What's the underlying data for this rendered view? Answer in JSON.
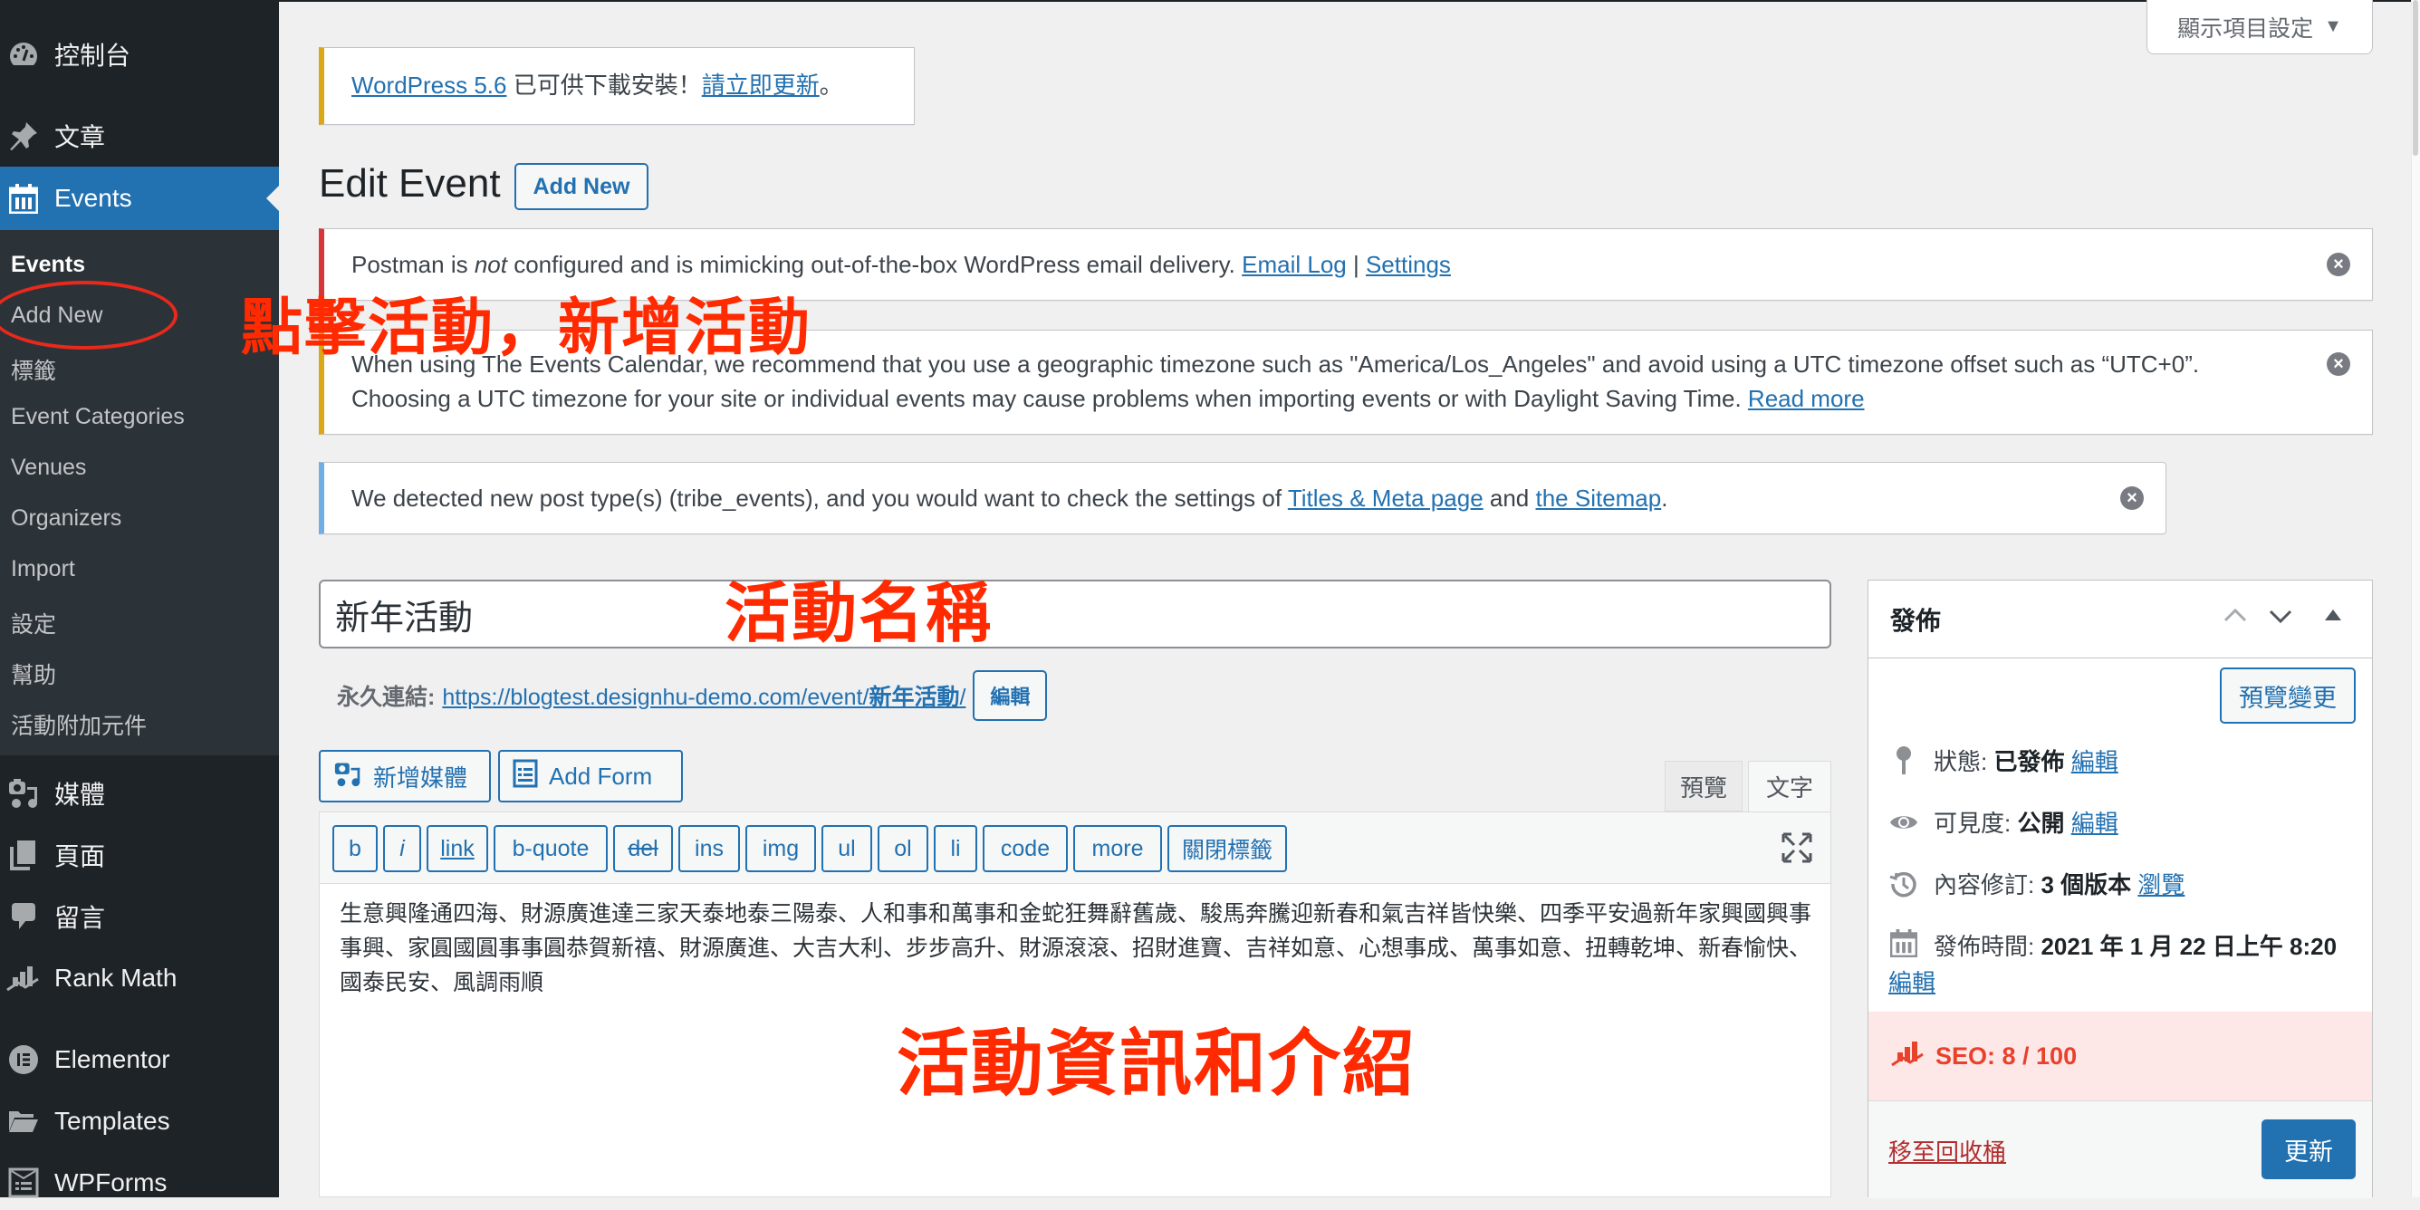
{
  "sidebar": {
    "top_items": [
      {
        "label": "控制台",
        "icon": "dashboard-icon"
      },
      {
        "label": "文章",
        "icon": "pin-icon"
      },
      {
        "label": "Events",
        "icon": "calendar-icon",
        "active": true
      }
    ],
    "submenu": [
      "Events",
      "Add New",
      "標籤",
      "Event Categories",
      "Venues",
      "Organizers",
      "Import",
      "設定",
      "幫助",
      "活動附加元件"
    ],
    "bottom_items": [
      {
        "label": "媒體",
        "icon": "media-icon"
      },
      {
        "label": "頁面",
        "icon": "pages-icon"
      },
      {
        "label": "留言",
        "icon": "comments-icon"
      },
      {
        "label": "Rank Math",
        "icon": "rank-math-icon"
      },
      {
        "label": "Elementor",
        "icon": "elementor-icon"
      },
      {
        "label": "Templates",
        "icon": "folder-icon"
      },
      {
        "label": "WPForms",
        "icon": "wpforms-icon"
      }
    ]
  },
  "annotations": {
    "click_add": "點擊活動，新增活動",
    "event_name": "活動名稱",
    "event_info": "活動資訊和介紹"
  },
  "screen_options": {
    "label": "顯示項目設定",
    "arrow": "▼"
  },
  "update_notice": {
    "link1": "WordPress 5.6",
    "text": " 已可供下載安裝！",
    "link2": "請立即更新",
    "tail": "。"
  },
  "page": {
    "title": "Edit Event",
    "add_new": "Add New"
  },
  "notices": {
    "postman": {
      "pre": "Postman is ",
      "em": "not",
      "post": " configured and is mimicking out-of-the-box WordPress email delivery. ",
      "link1": "Email Log",
      "sep": " | ",
      "link2": "Settings"
    },
    "timezone": {
      "line1": "When using The Events Calendar, we recommend that you use a geographic timezone such as \"America/Los_Angeles\" and avoid using a UTC timezone offset such as “UTC+0”.",
      "line2": "Choosing a UTC timezone for your site or individual events may cause problems when importing events or with Daylight Saving Time. ",
      "link": "Read more"
    },
    "post_type": {
      "pre": "We detected new post type(s) (tribe_events), and you would want to check the settings of ",
      "link1": "Titles & Meta page",
      "mid": " and ",
      "link2": "the Sitemap",
      "tail": "."
    },
    "dismiss": "×"
  },
  "editor": {
    "title_value": "新年活動",
    "permalink_label": "永久連結:",
    "permalink_url": "https://blogtest.designhu-demo.com/event/",
    "permalink_slug": "新年活動",
    "permalink_tail": "/",
    "permalink_edit": "編輯",
    "add_media": "新增媒體",
    "add_form": "Add Form",
    "tab_visual": "預覽",
    "tab_text": "文字",
    "quicktags": [
      "b",
      "i",
      "link",
      "b-quote",
      "del",
      "ins",
      "img",
      "ul",
      "ol",
      "li",
      "code",
      "more",
      "關閉標籤"
    ],
    "content": "生意興隆通四海、財源廣進達三家天泰地泰三陽泰、人和事和萬事和金蛇狂舞辭舊歲、駿馬奔騰迎新春和氣吉祥皆快樂、四季平安過新年家興國興事事興、家圓國圓事事圓恭賀新禧、財源廣進、大吉大利、步步高升、財源滾滾、招財進寶、吉祥如意、心想事成、萬事如意、扭轉乾坤、新春愉快、國泰民安、風調雨順"
  },
  "publish": {
    "title": "發佈",
    "preview_changes": "預覽變更",
    "status_label": "狀態:",
    "status_value": "已發佈",
    "status_edit": "編輯",
    "visibility_label": "可見度:",
    "visibility_value": "公開",
    "visibility_edit": "編輯",
    "revisions_label": "內容修訂:",
    "revisions_value": "3 個版本",
    "revisions_link": "瀏覽",
    "published_label": "發佈時間:",
    "published_value": "2021 年 1 月 22 日上午 8:20",
    "published_edit": "編輯",
    "seo": "SEO: 8 / 100",
    "trash": "移至回收桶",
    "update": "更新"
  }
}
